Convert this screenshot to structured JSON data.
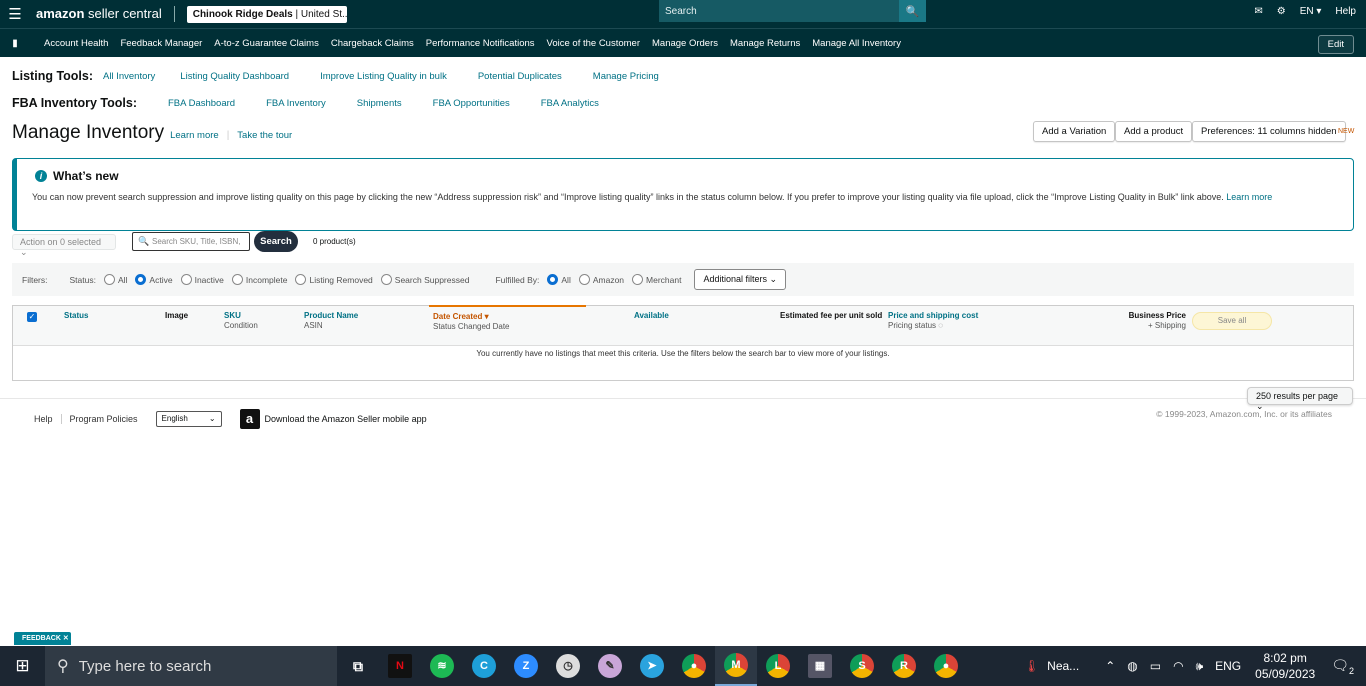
{
  "topbar": {
    "brand_a": "amazon",
    "brand_b": " seller central",
    "store_name": "Chinook Ridge Deals",
    "store_region": " | United St...",
    "search_placeholder": "Search",
    "lang": "EN",
    "help": "Help"
  },
  "nav": {
    "items": [
      "Account Health",
      "Feedback Manager",
      "A-to-z Guarantee Claims",
      "Chargeback Claims",
      "Performance Notifications",
      "Voice of the Customer",
      "Manage Orders",
      "Manage Returns",
      "Manage All Inventory"
    ],
    "edit": "Edit"
  },
  "listing_tools": {
    "label": "Listing Tools:",
    "links": [
      "All Inventory",
      "Listing Quality Dashboard",
      "Improve Listing Quality in bulk",
      "Potential Duplicates",
      "Manage Pricing"
    ]
  },
  "fba_tools": {
    "label": "FBA Inventory Tools:",
    "links": [
      "FBA Dashboard",
      "FBA Inventory",
      "Shipments",
      "FBA Opportunities",
      "FBA Analytics"
    ]
  },
  "page": {
    "title": "Manage Inventory",
    "learn_more": "Learn more",
    "tour": "Take the tour",
    "add_variation": "Add a Variation",
    "add_product": "Add a product",
    "preferences": "Preferences: 11 columns hidden",
    "new_tag": "NEW"
  },
  "whats_new": {
    "title": "What’s new",
    "text": "You can now prevent search suppression and improve listing quality on this page by clicking the new “Address suppression risk” and “Improve listing quality” links in the status column below. If you prefer to improve your listing quality via file upload, click the “Improve Listing Quality in Bulk” link above.",
    "link": "Learn more"
  },
  "actions": {
    "action_select": "Action on 0 selected",
    "search_placeholder": "Search SKU, Title, ISBN,",
    "search_button": "Search",
    "count": "0 product(s)"
  },
  "filters": {
    "label": "Filters:",
    "status_label": "Status:",
    "status_options": [
      "All",
      "Active",
      "Inactive",
      "Incomplete",
      "Listing Removed",
      "Search Suppressed"
    ],
    "fulfilled_label": "Fulfilled By:",
    "fulfilled_options": [
      "All",
      "Amazon",
      "Merchant"
    ],
    "additional": "Additional filters"
  },
  "table": {
    "status": "Status",
    "image": "Image",
    "sku": "SKU",
    "condition": "Condition",
    "product_name": "Product Name",
    "asin": "ASIN",
    "date_created": "Date Created ▾",
    "status_changed": "Status Changed Date",
    "available": "Available",
    "est_fee": "Estimated fee per unit sold",
    "price": "Price and shipping cost",
    "pricing_status": "Pricing status",
    "business_price": "Business Price",
    "shipping": "+ Shipping",
    "save_all": "Save all",
    "empty": "You currently have no listings that meet this criteria. Use the filters below the search bar to view more of your listings."
  },
  "results_per_page": "250 results per page",
  "footer": {
    "help": "Help",
    "policies": "Program Policies",
    "language": "English",
    "app": "Download the Amazon Seller mobile app",
    "copyright": "© 1999-2023, Amazon.com, Inc. or its affiliates"
  },
  "feedback": "FEEDBACK ✕",
  "taskbar": {
    "search": "Type here to search",
    "weather": "Nea...",
    "lang": "ENG",
    "time": "8:02 pm",
    "date": "05/09/2023",
    "notif": "2"
  }
}
